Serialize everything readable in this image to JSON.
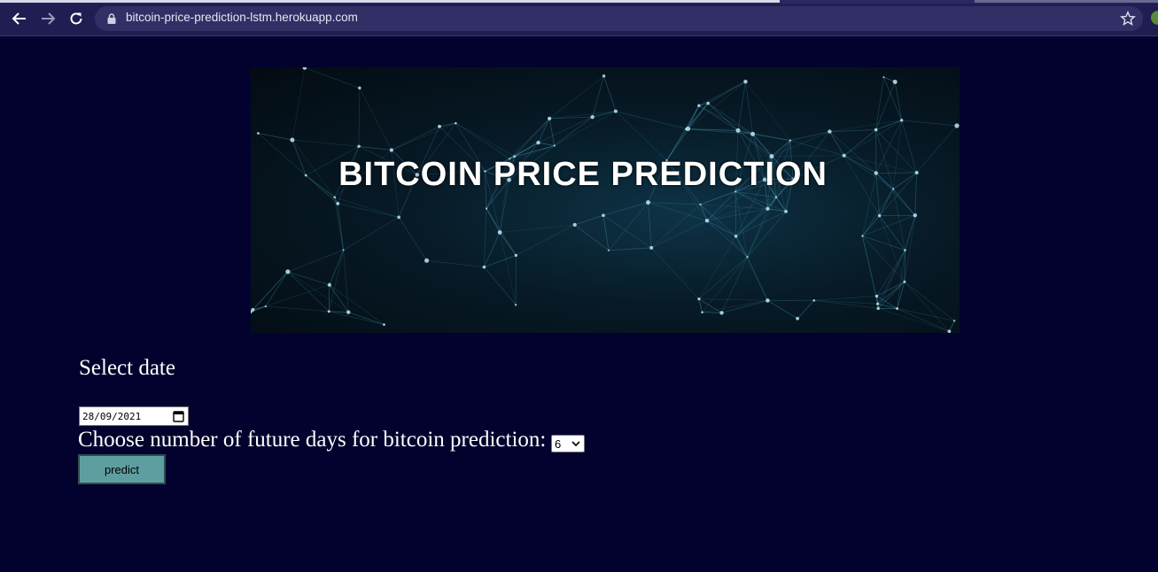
{
  "browser": {
    "url": "bitcoin-price-prediction-lstm.herokuapp.com",
    "icons": [
      "back-arrow-icon",
      "forward-arrow-icon",
      "reload-icon",
      "lock-icon",
      "star-icon"
    ]
  },
  "banner": {
    "title": "BITCOIN PRICE PREDICTION"
  },
  "form": {
    "date_label": "Select date",
    "date_value": "28/09/2021",
    "days_label": "Choose number of future days for bitcoin prediction:",
    "days_selected": "6",
    "predict_label": "predict"
  },
  "colors": {
    "page_background": "#03022e",
    "button_background": "#5f9ea0"
  }
}
